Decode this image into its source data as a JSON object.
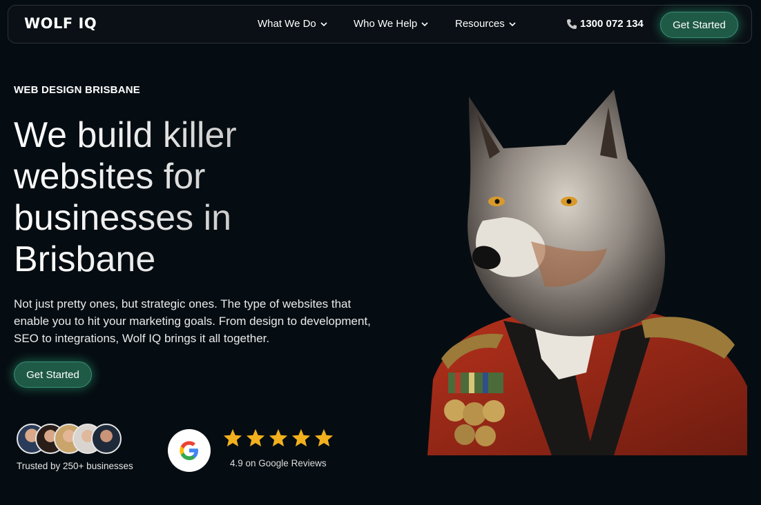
{
  "nav": {
    "logo": "WOLF IQ",
    "items": [
      {
        "label": "What We Do"
      },
      {
        "label": "Who We Help"
      },
      {
        "label": "Resources"
      }
    ],
    "phone": "1300 072 134",
    "cta": "Get Started"
  },
  "hero": {
    "eyebrow": "WEB DESIGN BRISBANE",
    "headline_lines": [
      "We build killer",
      "websites for",
      "businesses in",
      "Brisbane"
    ],
    "description": "Not just pretty ones, but strategic ones. The type of websites that enable you to hit your marketing goals. From design to development, SEO to integrations, Wolf IQ brings it all together.",
    "cta": "Get Started"
  },
  "social_proof": {
    "trusted": "Trusted by 250+ businesses",
    "rating_text": "4.9 on Google Reviews",
    "stars": 5,
    "star_color": "#f2b01e"
  },
  "colors": {
    "background": "#060d12",
    "accent": "#1f5a47"
  }
}
